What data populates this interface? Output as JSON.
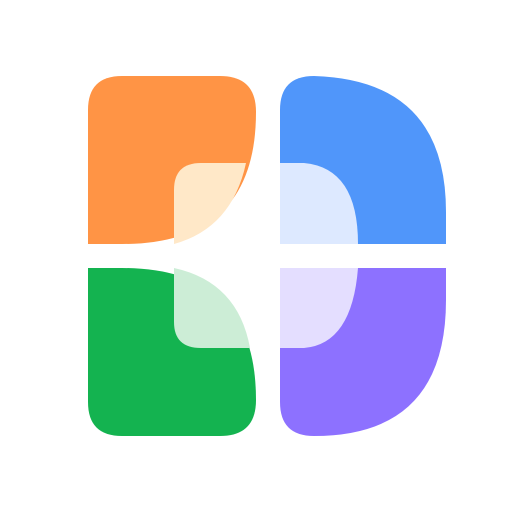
{
  "logo": {
    "icon": "four-petal-app-logo-icon",
    "colors": {
      "top_left": "#FF9445",
      "top_left_overlay": "#FFE8C8",
      "top_right": "#5096FA",
      "top_right_overlay": "#DDE9FF",
      "bottom_left": "#14B350",
      "bottom_left_overlay": "#CCEDD6",
      "bottom_right": "#8D71FF",
      "bottom_right_overlay": "#E4DEFF",
      "background": "#FFFFFF"
    }
  }
}
